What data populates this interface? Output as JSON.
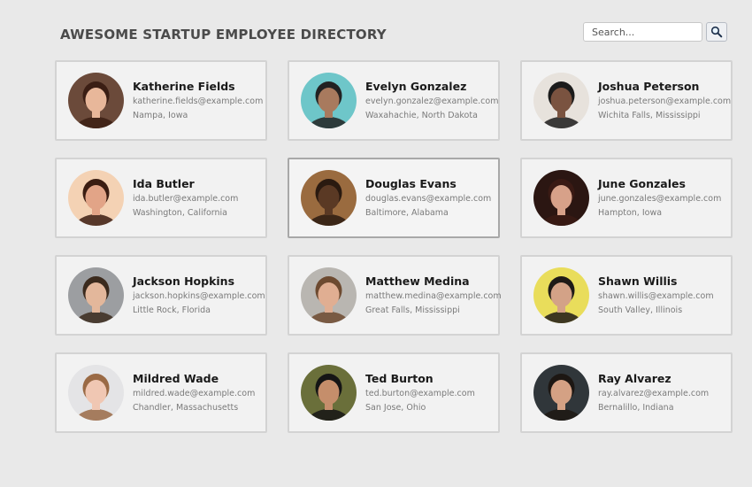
{
  "header": {
    "title": "AWESOME STARTUP EMPLOYEE DIRECTORY"
  },
  "search": {
    "placeholder": "Search...",
    "value": "",
    "button_icon": "magnifier-icon"
  },
  "employees": [
    {
      "name": "Katherine Fields",
      "email": "katherine.fields@example.com",
      "location": "Nampa, Iowa",
      "bg": "#6b4a3a",
      "skin": "#e8b79a",
      "hair": "#3b1e14"
    },
    {
      "name": "Evelyn Gonzalez",
      "email": "evelyn.gonzalez@example.com",
      "location": "Waxahachie, North Dakota",
      "bg": "#6ec6c9",
      "skin": "#a87a5e",
      "hair": "#222222"
    },
    {
      "name": "Joshua Peterson",
      "email": "joshua.peterson@example.com",
      "location": "Wichita Falls, Mississippi",
      "bg": "#e7e2dc",
      "skin": "#7a5340",
      "hair": "#1b1b1b"
    },
    {
      "name": "Ida Butler",
      "email": "ida.butler@example.com",
      "location": "Washington, California",
      "bg": "#f4d2b4",
      "skin": "#e2a487",
      "hair": "#3b1d12"
    },
    {
      "name": "Douglas Evans",
      "email": "douglas.evans@example.com",
      "location": "Baltimore, Alabama",
      "bg": "#9a6b3f",
      "skin": "#5a3924",
      "hair": "#2a1a10"
    },
    {
      "name": "June Gonzales",
      "email": "june.gonzales@example.com",
      "location": "Hampton, Iowa",
      "bg": "#2b1612",
      "skin": "#d7a189",
      "hair": "#3a1a14"
    },
    {
      "name": "Jackson Hopkins",
      "email": "jackson.hopkins@example.com",
      "location": "Little Rock, Florida",
      "bg": "#9c9ea1",
      "skin": "#e3b79b",
      "hair": "#3b2a1d"
    },
    {
      "name": "Matthew Medina",
      "email": "matthew.medina@example.com",
      "location": "Great Falls, Mississippi",
      "bg": "#b9b6b1",
      "skin": "#e0ae92",
      "hair": "#6d4a30"
    },
    {
      "name": "Shawn Willis",
      "email": "shawn.willis@example.com",
      "location": "South Valley, Illinois",
      "bg": "#e9dd5b",
      "skin": "#d3a287",
      "hair": "#1e1a17"
    },
    {
      "name": "Mildred Wade",
      "email": "mildred.wade@example.com",
      "location": "Chandler, Massachusetts",
      "bg": "#e4e4e6",
      "skin": "#f0c7b3",
      "hair": "#9a6a45"
    },
    {
      "name": "Ted Burton",
      "email": "ted.burton@example.com",
      "location": "San Jose, Ohio",
      "bg": "#6a6f3a",
      "skin": "#c58e6b",
      "hair": "#151515"
    },
    {
      "name": "Ray Alvarez",
      "email": "ray.alvarez@example.com",
      "location": "Bernalillo, Indiana",
      "bg": "#30363a",
      "skin": "#d4a184",
      "hair": "#1d1713"
    }
  ],
  "active_index": 4
}
